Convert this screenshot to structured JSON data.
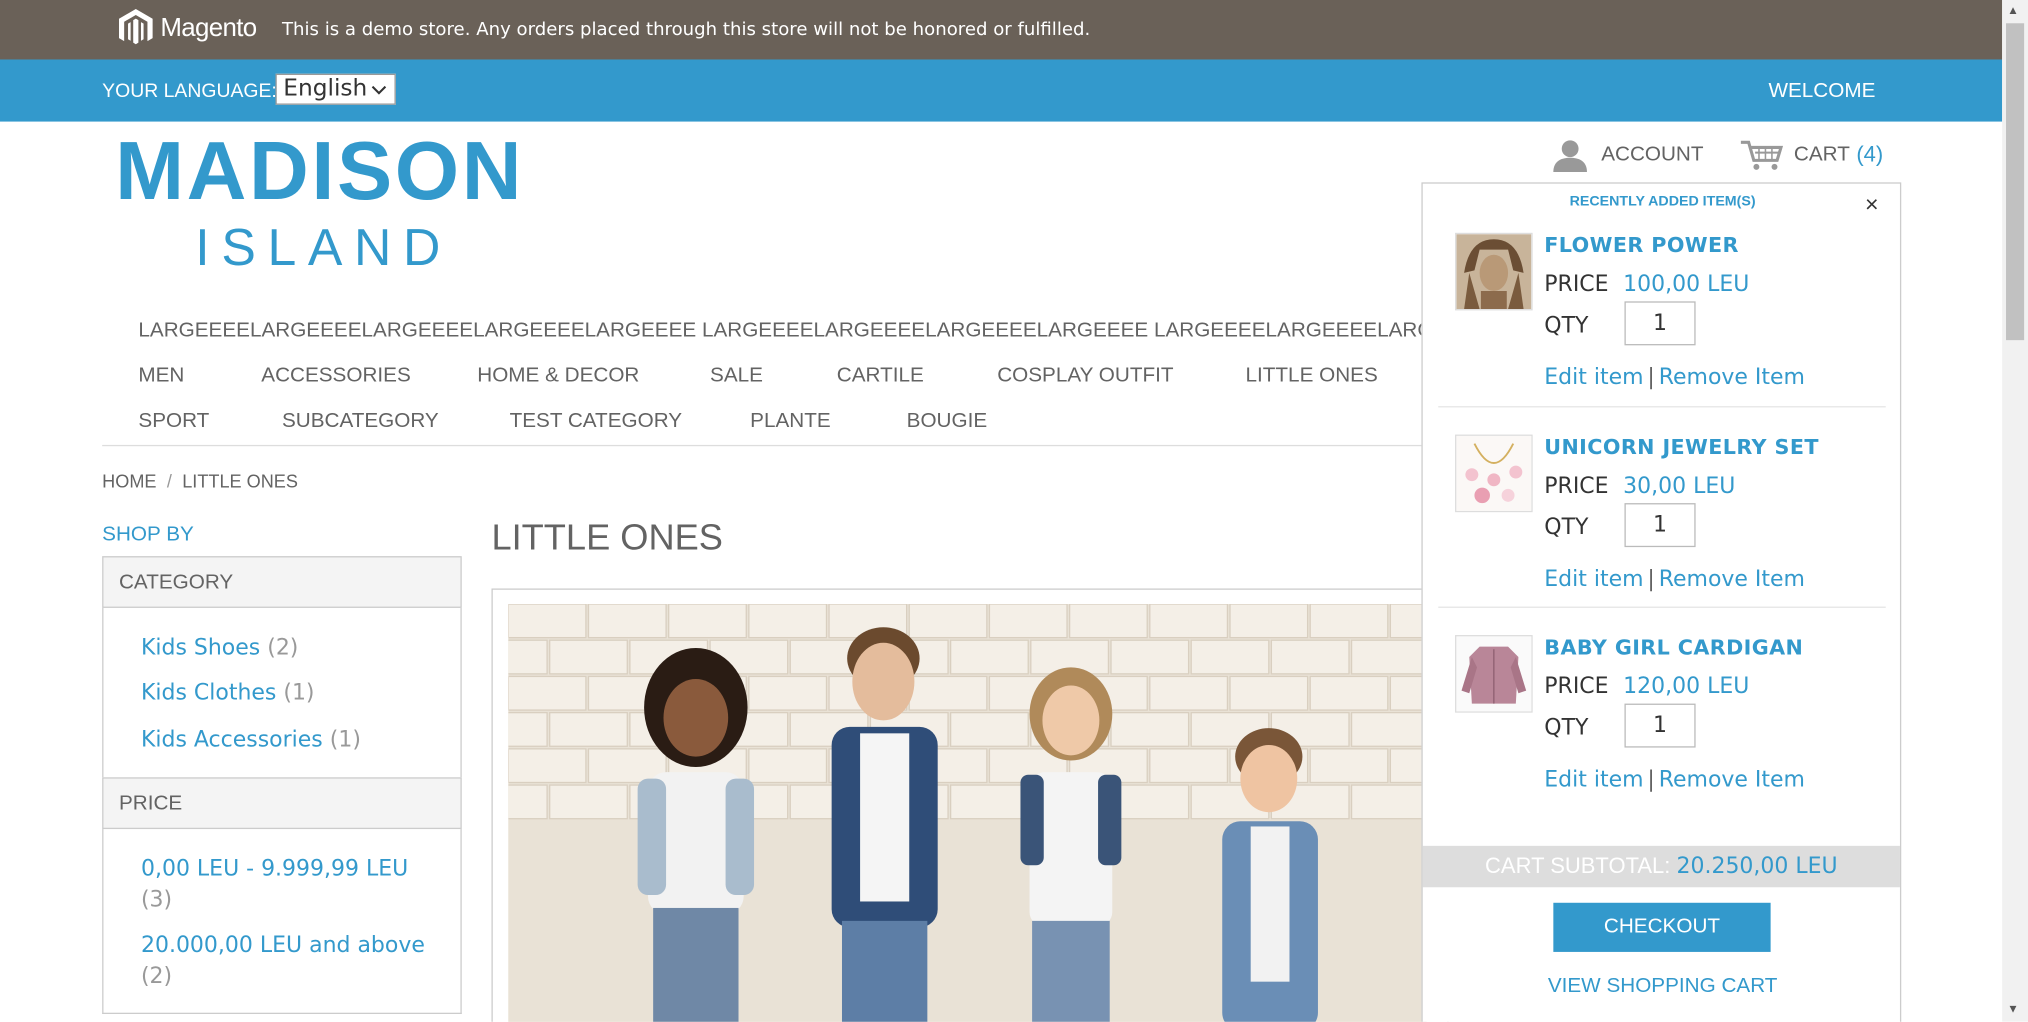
{
  "notice": {
    "brand": "Magento",
    "text": "This is a demo store. Any orders placed through this store will not be honored or fulfilled."
  },
  "lang": {
    "label": "YOUR LANGUAGE:",
    "selected": "English",
    "welcome": "WELCOME"
  },
  "logo": {
    "line1": "MADISON",
    "line2": "ISLAND"
  },
  "header": {
    "account": "ACCOUNT",
    "cart": "CART",
    "cart_count": "(4)"
  },
  "nav": {
    "long_item": "LARGEEEELARGEEEELARGEEEELARGEEEELARGEEEE LARGEEEELARGEEEELARGEEEELARGEEEE LARGEEEELARGEEEELARGEEEE",
    "row1": [
      "MEN",
      "ACCESSORIES",
      "HOME & DECOR",
      "SALE",
      "CARTILE",
      "COSPLAY OUTFIT",
      "LITTLE ONES"
    ],
    "row2": [
      "SPORT",
      "SUBCATEGORY",
      "TEST CATEGORY",
      "PLANTE",
      "BOUGIE"
    ]
  },
  "breadcrumb": {
    "home": "HOME",
    "sep": "/",
    "current": "LITTLE ONES"
  },
  "sidebar": {
    "shop_by": "SHOP BY",
    "category_title": "CATEGORY",
    "categories": [
      {
        "label": "Kids Shoes",
        "count": "(2)"
      },
      {
        "label": "Kids Clothes",
        "count": "(1)"
      },
      {
        "label": "Kids Accessories",
        "count": "(1)"
      }
    ],
    "price_title": "PRICE",
    "prices": [
      {
        "label": "0,00 LEU - 9.999,99 LEU",
        "count": "(3)"
      },
      {
        "label": "20.000,00 LEU and above",
        "count": "(2)"
      }
    ]
  },
  "main": {
    "title": "LITTLE ONES"
  },
  "minicart": {
    "title": "RECENTLY ADDED ITEM(S)",
    "close": "×",
    "price_label": "PRICE",
    "qty_label": "QTY",
    "edit": "Edit item",
    "remove": "Remove Item",
    "link_sep": "|",
    "items": [
      {
        "name": "FLOWER POWER",
        "price": "100,00 LEU",
        "qty": "1"
      },
      {
        "name": "UNICORN JEWELRY SET",
        "price": "30,00 LEU",
        "qty": "1"
      },
      {
        "name": "BABY GIRL CARDIGAN",
        "price": "120,00 LEU",
        "qty": "1"
      }
    ],
    "subtotal_label": "CART SUBTOTAL:",
    "subtotal_value": "20.250,00 LEU",
    "checkout": "CHECKOUT",
    "view_cart": "VIEW SHOPPING CART"
  },
  "colors": {
    "accent": "#3399cc",
    "notice_bg": "#6a6158",
    "text": "#636363"
  }
}
